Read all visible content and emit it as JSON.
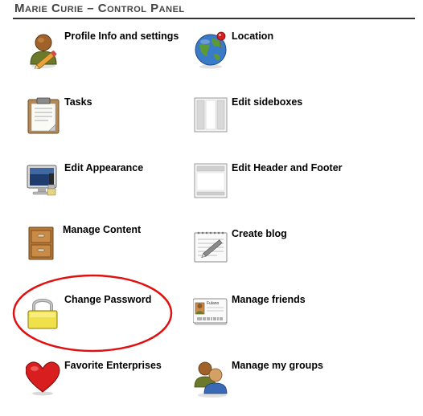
{
  "header": {
    "title": "Marie Curie – Control Panel"
  },
  "items": [
    {
      "label": "Profile Info and settings",
      "icon": "user-edit-icon"
    },
    {
      "label": "Location",
      "icon": "globe-pin-icon"
    },
    {
      "label": "Tasks",
      "icon": "clipboard-icon"
    },
    {
      "label": "Edit sideboxes",
      "icon": "sideboxes-layout-icon"
    },
    {
      "label": "Edit Appearance",
      "icon": "monitor-paintbrush-icon"
    },
    {
      "label": "Edit Header and Footer",
      "icon": "header-footer-layout-icon"
    },
    {
      "label": "Manage Content",
      "icon": "cabinet-icon"
    },
    {
      "label": "Create blog",
      "icon": "notepad-pencil-icon"
    },
    {
      "label": "Change Password",
      "icon": "padlock-icon"
    },
    {
      "label": "Manage friends",
      "icon": "id-cards-icon"
    },
    {
      "label": "Favorite Enterprises",
      "icon": "heart-icon"
    },
    {
      "label": "Manage my groups",
      "icon": "group-users-icon"
    }
  ],
  "id_card_text": "Fulano",
  "highlight_color": "#e01010"
}
